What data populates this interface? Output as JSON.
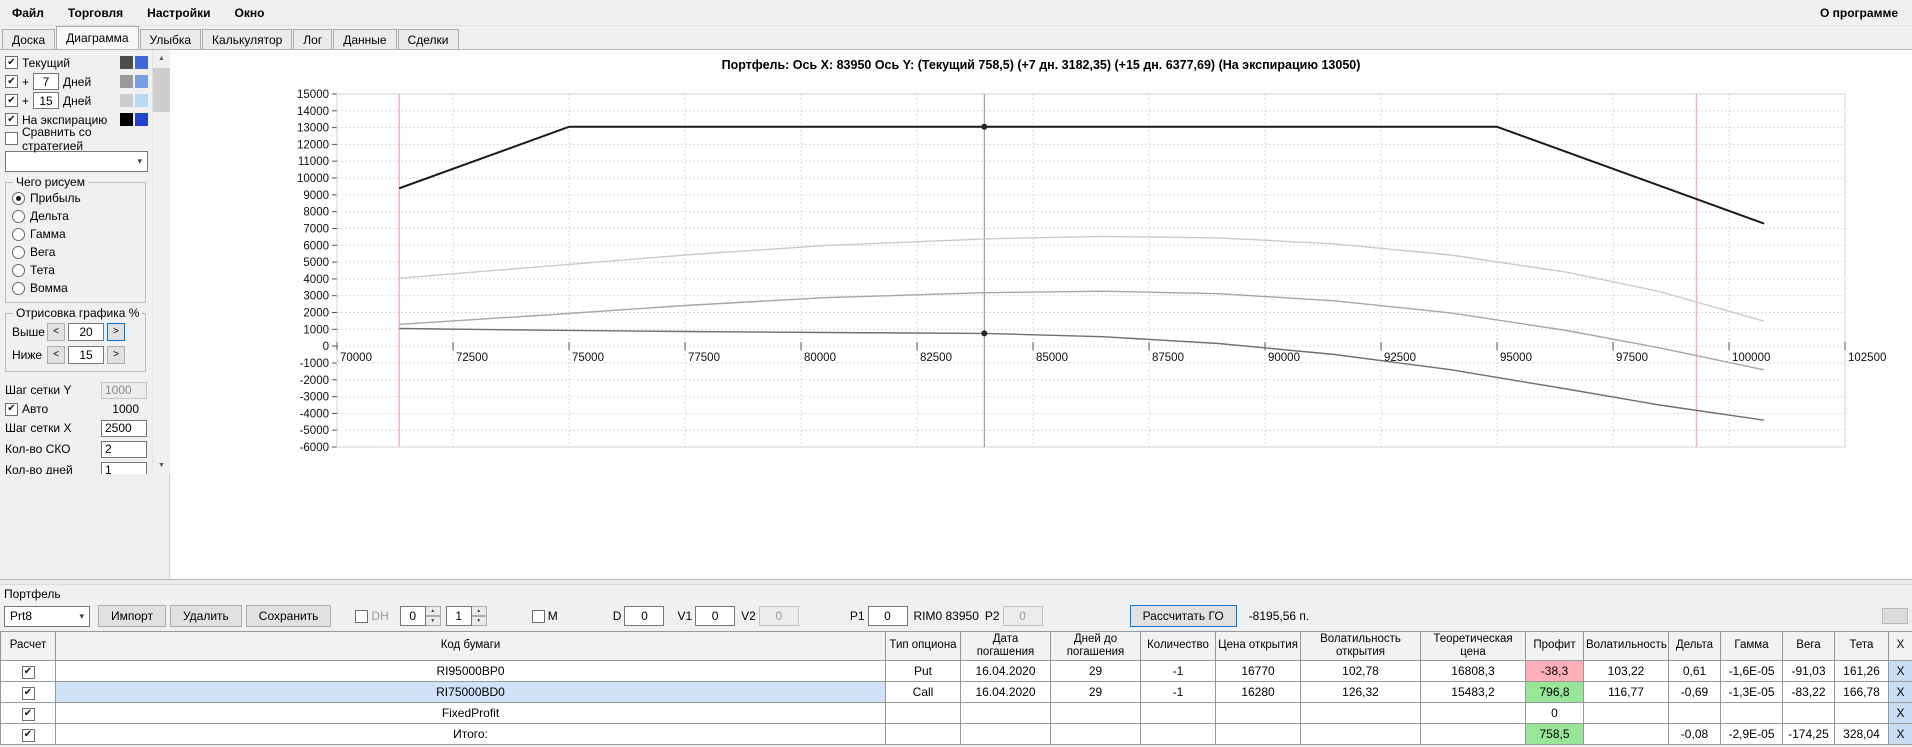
{
  "menubar": {
    "items": [
      "Файл",
      "Торговля",
      "Настройки",
      "Окно"
    ],
    "right_item": "О программе"
  },
  "tabbar": {
    "tabs": [
      "Доска",
      "Диаграмма",
      "Улыбка",
      "Калькулятор",
      "Лог",
      "Данные",
      "Сделки"
    ],
    "active": "Диаграмма"
  },
  "sidebar": {
    "current": {
      "label": "Текущий",
      "checked": true,
      "colors": [
        "#4d4d4d",
        "#4168d6"
      ]
    },
    "plus7": {
      "prefix": "+",
      "value": "7",
      "suffix": "Дней",
      "checked": true,
      "colors": [
        "#9b9b9b",
        "#7b9de2"
      ]
    },
    "plus15": {
      "prefix": "+",
      "value": "15",
      "suffix": "Дней",
      "checked": true,
      "colors": [
        "#cdcdcd",
        "#b9d9f2"
      ]
    },
    "expiry": {
      "label": "На экспирацию",
      "checked": true,
      "colors": [
        "#000000",
        "#2343cf"
      ]
    },
    "compare": {
      "label": "Сравнить со стратегией",
      "checked": false
    },
    "strategy_combo": "",
    "draw_group": {
      "title": "Чего рисуем",
      "options": [
        "Прибыль",
        "Дельта",
        "Гамма",
        "Вега",
        "Тета",
        "Вомма"
      ],
      "selected": "Прибыль"
    },
    "render_group": {
      "title": "Отрисовка графика %",
      "above_label": "Выше",
      "above_value": "20",
      "below_label": "Ниже",
      "below_value": "15"
    },
    "grid_y": {
      "label": "Шаг сетки Y",
      "value": "1000"
    },
    "auto": {
      "label": "Авто",
      "checked": true,
      "value": "1000"
    },
    "grid_x": {
      "label": "Шаг сетки X",
      "value": "2500"
    },
    "sko": {
      "label": "Кол-во СКО",
      "value": "2"
    },
    "days": {
      "label": "Кол-во дней",
      "value": "1"
    }
  },
  "chart_data": {
    "type": "line",
    "title": "Портфель: Ось X: 83950 Ось Y:  (Текущий 758,5)  (+7 дн. 3182,35)  (+15 дн. 6377,69)  (На экспирацию 13050)",
    "x_min": 70000,
    "x_max": 102500,
    "x_step": 2500,
    "y_min": -6000,
    "y_max": 15000,
    "y_step": 1000,
    "grid": true,
    "legend_position": "none",
    "crosshair_x": 83950,
    "vlines": [
      {
        "name": "lower-band",
        "x": 71340,
        "color": "#f3b3c2",
        "width": 1.5
      },
      {
        "name": "upper-band",
        "x": 99300,
        "color": "#f3b3c2",
        "width": 1.5
      },
      {
        "name": "current-price",
        "x": 83950,
        "color": "#8a8a8a",
        "width": 1
      }
    ],
    "series": [
      {
        "name": "+15 дней",
        "color": "#c9c9c9",
        "width": 1.4,
        "value_at_x": 6377.69,
        "points": [
          [
            71357,
            4050
          ],
          [
            74500,
            4750
          ],
          [
            77500,
            5420
          ],
          [
            80500,
            5980
          ],
          [
            83950,
            6377
          ],
          [
            86500,
            6530
          ],
          [
            89000,
            6440
          ],
          [
            91500,
            6080
          ],
          [
            94000,
            5420
          ],
          [
            96500,
            4400
          ],
          [
            98500,
            3250
          ],
          [
            100740,
            1500
          ]
        ]
      },
      {
        "name": "+7 дней",
        "color": "#a6a6a6",
        "width": 1.4,
        "value_at_x": 3182.35,
        "points": [
          [
            71357,
            1300
          ],
          [
            74500,
            1850
          ],
          [
            77500,
            2420
          ],
          [
            80500,
            2880
          ],
          [
            83950,
            3182
          ],
          [
            86500,
            3270
          ],
          [
            89000,
            3120
          ],
          [
            91500,
            2700
          ],
          [
            94000,
            1980
          ],
          [
            96500,
            930
          ],
          [
            98500,
            -100
          ],
          [
            100740,
            -1400
          ]
        ]
      },
      {
        "name": "Текущий",
        "color": "#6e6e6e",
        "width": 1.4,
        "value_at_x": 758.5,
        "points": [
          [
            71357,
            1050
          ],
          [
            74500,
            950
          ],
          [
            77500,
            870
          ],
          [
            80500,
            810
          ],
          [
            83950,
            758.5
          ],
          [
            86500,
            560
          ],
          [
            89000,
            160
          ],
          [
            91500,
            -500
          ],
          [
            94000,
            -1400
          ],
          [
            96500,
            -2550
          ],
          [
            98500,
            -3500
          ],
          [
            100740,
            -4400
          ]
        ],
        "markers": [
          [
            83950,
            758.5
          ]
        ]
      },
      {
        "name": "На экспирацию",
        "color": "#1b1b1b",
        "width": 2,
        "value_at_x": 13050,
        "points": [
          [
            71357,
            9407
          ],
          [
            75000,
            13050
          ],
          [
            95000,
            13050
          ],
          [
            100740,
            7310
          ]
        ],
        "markers": [
          [
            83950,
            13050
          ]
        ]
      }
    ]
  },
  "portfolio_panel": {
    "title": "Портфель",
    "combo_value": "Prt8",
    "import_button": "Импорт",
    "delete_button": "Удалить",
    "save_button": "Сохранить",
    "dh_label": "DH",
    "spin1_value": "0",
    "spin2_value": "1",
    "m_label": "M",
    "d_label": "D",
    "d_value": "0",
    "v1_label": "V1",
    "v1_value": "0",
    "v2_label": "V2",
    "v2_value": "0",
    "p1_label": "P1",
    "p1_value": "0",
    "rim_label": "RIM0 83950",
    "p2_label": "P2",
    "p2_value": "0",
    "calc_go_button": "Рассчитать ГО",
    "go_value": "-8195,56 п."
  },
  "table": {
    "headers": [
      "Расчет",
      "Код бумаги",
      "Тип опциона",
      "Дата погашения",
      "Дней до погашения",
      "Количество",
      "Цена открытия",
      "Волатильность открытия",
      "Теоретическая цена",
      "Профит",
      "Волатильность",
      "Дельта",
      "Гамма",
      "Вега",
      "Тета",
      "X"
    ],
    "x_label": "X",
    "rows": [
      {
        "checked": true,
        "selected_code": false,
        "profit": "neg",
        "cells": [
          "RI95000BP0",
          "Put",
          "16.04.2020",
          "29",
          "-1",
          "16770",
          "102,78",
          "16808,3",
          "-38,3",
          "103,22",
          "0,61",
          "-1,6E-05",
          "-91,03",
          "161,26"
        ]
      },
      {
        "checked": true,
        "selected_code": true,
        "profit": "pos",
        "cells": [
          "RI75000BD0",
          "Call",
          "16.04.2020",
          "29",
          "-1",
          "16280",
          "126,32",
          "15483,2",
          "796,8",
          "116,77",
          "-0,69",
          "-1,3E-05",
          "-83,22",
          "166,78"
        ]
      },
      {
        "checked": true,
        "selected_code": false,
        "profit": "none",
        "cells": [
          "FixedProfit",
          "",
          "",
          "",
          "",
          "",
          "",
          "",
          "0",
          "",
          "",
          "",
          "",
          ""
        ]
      },
      {
        "checked": true,
        "selected_code": false,
        "profit": "pos",
        "cells": [
          "Итого:",
          "",
          "",
          "",
          "",
          "",
          "",
          "",
          "758,5",
          "",
          "-0,08",
          "-2,9E-05",
          "-174,25",
          "328,04"
        ]
      }
    ]
  }
}
